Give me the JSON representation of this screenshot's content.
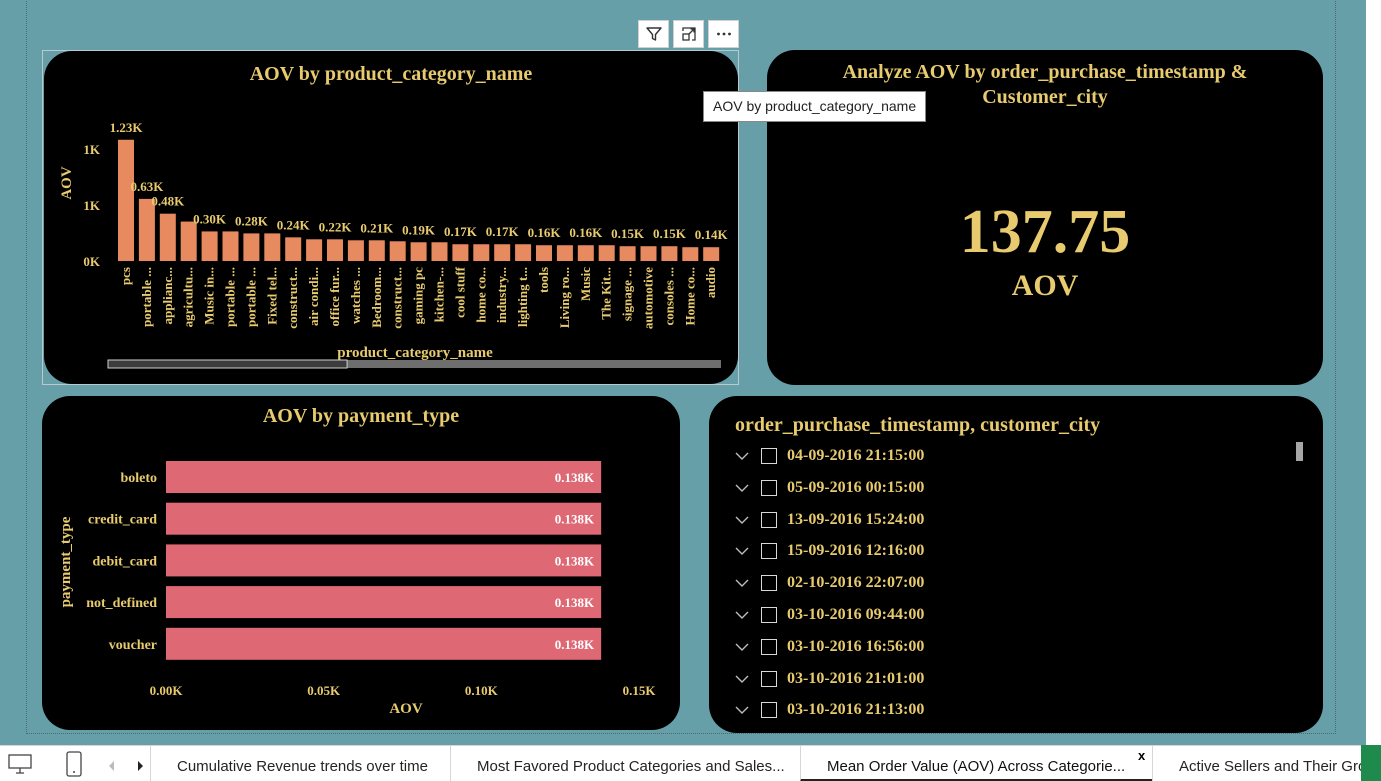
{
  "toolbar": {
    "icons": [
      "filter-icon",
      "focus-mode-icon",
      "more-options-icon"
    ]
  },
  "tooltip": {
    "text": "AOV by product_category_name"
  },
  "colors": {
    "background": "#679fa9",
    "card": "#000000",
    "title_gold": "#e8cb6e",
    "bar_orange": "#e88a60",
    "bar_pink": "#de6874"
  },
  "category_card": {
    "title": "AOV by product_category_name"
  },
  "kpi_card": {
    "title_line1": "Analyze AOV by order_purchase_timestamp &",
    "title_line2": "Customer_city",
    "value": "137.75",
    "label": "AOV"
  },
  "payment_card": {
    "title": "AOV by payment_type"
  },
  "slicer": {
    "title": "order_purchase_timestamp, customer_city",
    "items": [
      "04-09-2016 21:15:00",
      "05-09-2016 00:15:00",
      "13-09-2016 15:24:00",
      "15-09-2016 12:16:00",
      "02-10-2016 22:07:00",
      "03-10-2016 09:44:00",
      "03-10-2016 16:56:00",
      "03-10-2016 21:01:00",
      "03-10-2016 21:13:00"
    ]
  },
  "chart_data": [
    {
      "type": "bar",
      "title": "AOV by product_category_name",
      "xlabel": "product_category_name",
      "ylabel": "AOV",
      "ylim": [
        0,
        1.4
      ],
      "y_ticks": [
        "0K",
        "1K",
        "1K"
      ],
      "categories": [
        "pcs",
        "portable ...",
        "applianc...",
        "agricultu...",
        "Music in...",
        "portable ...",
        "portable ...",
        "Fixed tel...",
        "construct...",
        "air condi...",
        "office fur...",
        "watches ...",
        "Bedroom...",
        "construct...",
        "gaming pc",
        "kitchen-...",
        "cool stuff",
        "home co...",
        "industry...",
        "lighting t...",
        "tools",
        "Living ro...",
        "Music",
        "The Kit...",
        "signage ...",
        "automotive",
        "consoles ...",
        "Home co...",
        "audio"
      ],
      "values": [
        1.23,
        0.63,
        0.48,
        0.4,
        0.3,
        0.3,
        0.28,
        0.28,
        0.24,
        0.22,
        0.22,
        0.21,
        0.21,
        0.2,
        0.19,
        0.19,
        0.17,
        0.17,
        0.17,
        0.17,
        0.16,
        0.16,
        0.16,
        0.16,
        0.15,
        0.15,
        0.15,
        0.14,
        0.14
      ],
      "data_labels": [
        "1.23K",
        "0.63K",
        "0.48K",
        "",
        "0.30K",
        "",
        "0.28K",
        "",
        "0.24K",
        "",
        "0.22K",
        "",
        "0.21K",
        "",
        "0.19K",
        "",
        "0.17K",
        "",
        "0.17K",
        "",
        "0.16K",
        "",
        "0.16K",
        "",
        "0.15K",
        "",
        "0.15K",
        "",
        "0.14K"
      ],
      "scrollbar_position": 0.39,
      "grid": false
    },
    {
      "type": "bar",
      "orientation": "horizontal",
      "title": "AOV by payment_type",
      "xlabel": "AOV",
      "ylabel": "payment_type",
      "xlim": [
        0,
        0.15
      ],
      "x_ticks": [
        "0.00K",
        "0.05K",
        "0.10K",
        "0.15K"
      ],
      "categories": [
        "boleto",
        "credit_card",
        "debit_card",
        "not_defined",
        "voucher"
      ],
      "values": [
        0.138,
        0.138,
        0.138,
        0.138,
        0.138
      ],
      "data_labels": [
        "0.138K",
        "0.138K",
        "0.138K",
        "0.138K",
        "0.138K"
      ],
      "grid": false
    }
  ],
  "bottom_bar": {
    "nav_icons": [
      "desktop-view-icon",
      "mobile-view-icon",
      "scroll-left-icon",
      "scroll-right-icon"
    ],
    "tabs": [
      "Cumulative Revenue trends over time",
      "Most Favored Product Categories and Sales...",
      "Mean Order Value (AOV) Across Categorie...",
      "Active Sellers and Their Gro"
    ],
    "close_label": "x"
  }
}
